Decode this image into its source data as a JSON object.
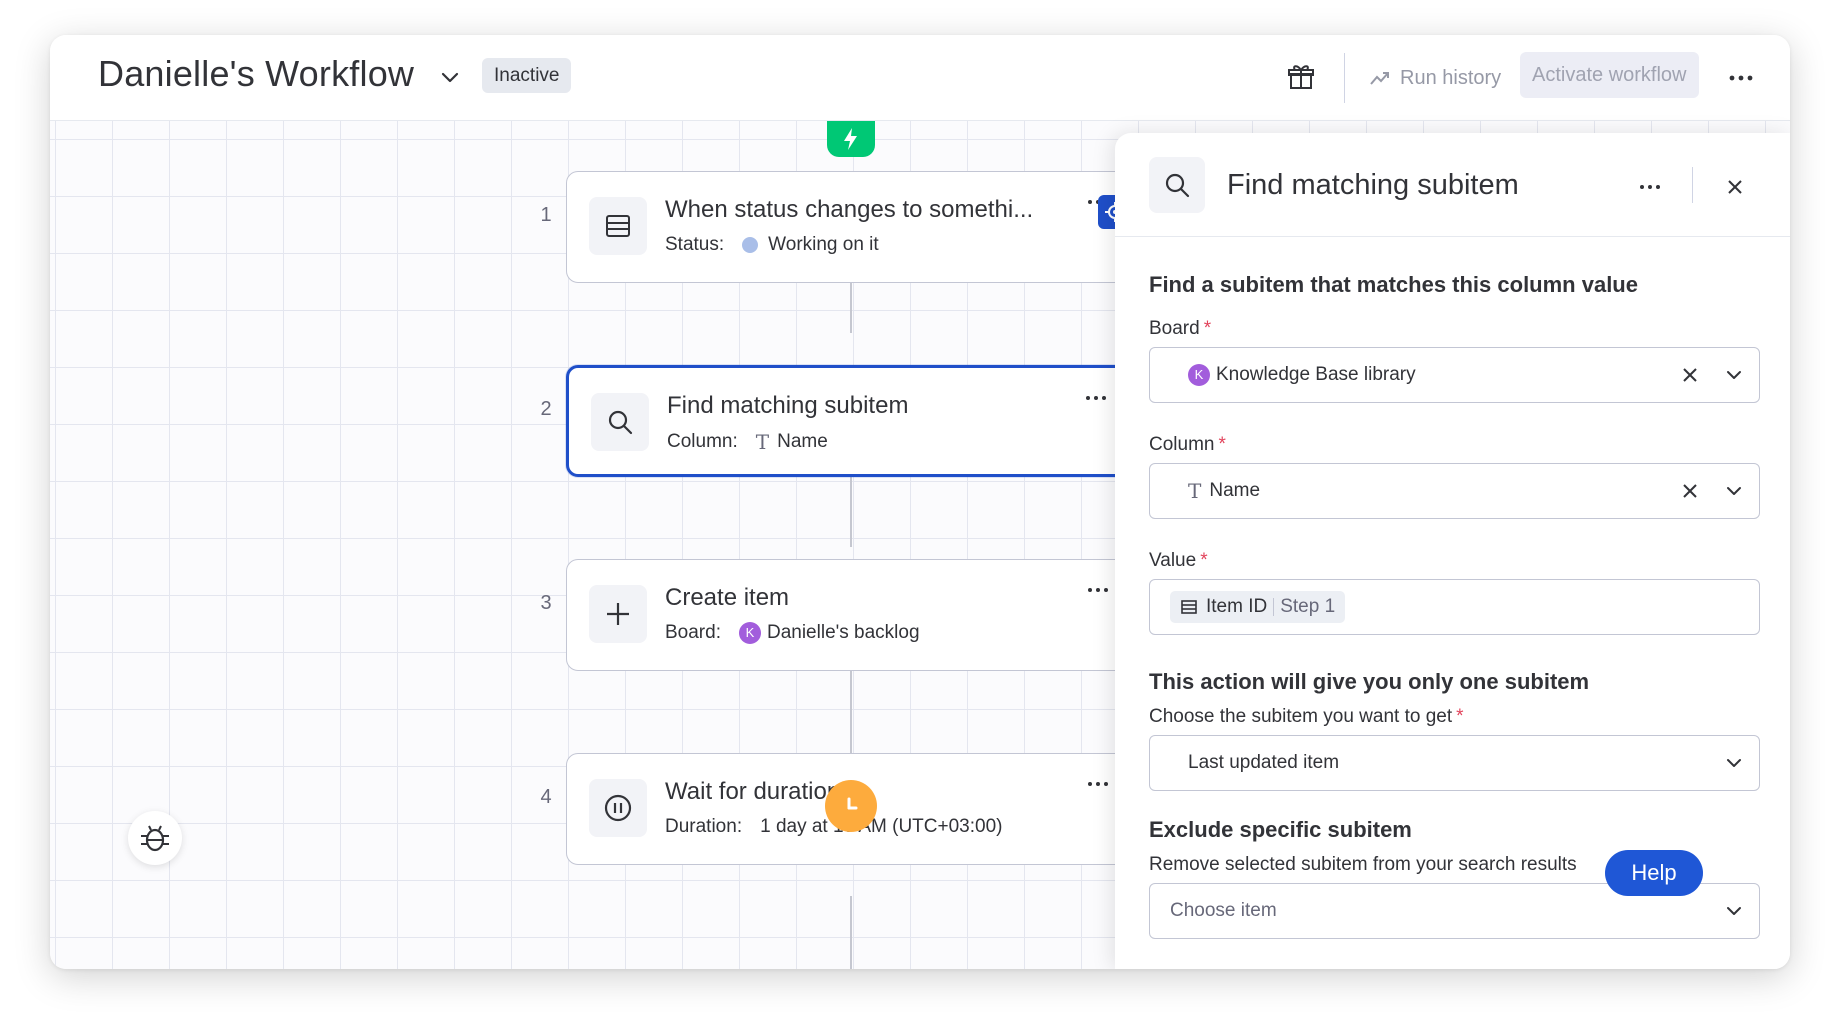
{
  "header": {
    "title": "Danielle's Workflow",
    "status": "Inactive",
    "run_history": "Run history",
    "activate": "Activate workflow"
  },
  "steps": [
    {
      "number": "1",
      "title": "When status changes to somethi...",
      "sub_label": "Status:",
      "sub_value": "Working on it",
      "icon": "table-icon"
    },
    {
      "number": "2",
      "title": "Find matching subitem",
      "sub_label": "Column:",
      "sub_value": "Name",
      "icon": "search-icon"
    },
    {
      "number": "3",
      "title": "Create item",
      "sub_label": "Board:",
      "sub_value": "Danielle's backlog",
      "badge": "K",
      "icon": "plus-icon"
    },
    {
      "number": "4",
      "title": "Wait for duration",
      "sub_label": "Duration:",
      "sub_value": "1 day at 10 AM (UTC+03:00)",
      "icon": "pause-icon"
    }
  ],
  "panel": {
    "title": "Find matching subitem",
    "section1_title": "Find a subitem that matches this column value",
    "board_label": "Board",
    "board_badge": "K",
    "board_value": "Knowledge Base library",
    "column_label": "Column",
    "column_value": "Name",
    "value_label": "Value",
    "value_token_main": "Item ID",
    "value_token_step": "Step 1",
    "section2_title": "This action will give you only one subitem",
    "choose_label": "Choose the subitem you want to get",
    "choose_value": "Last updated item",
    "section3_title": "Exclude specific subitem",
    "exclude_label": "Remove selected subitem from your search results",
    "exclude_placeholder": "Choose item"
  },
  "help": "Help",
  "colors": {
    "accent": "#1f4fc9",
    "trigger_green": "#00c875",
    "timer_orange": "#fdab3d",
    "board_badge_purple": "#a25ddc",
    "status_dot": "#a9bee8",
    "required_red": "#e2445c"
  }
}
